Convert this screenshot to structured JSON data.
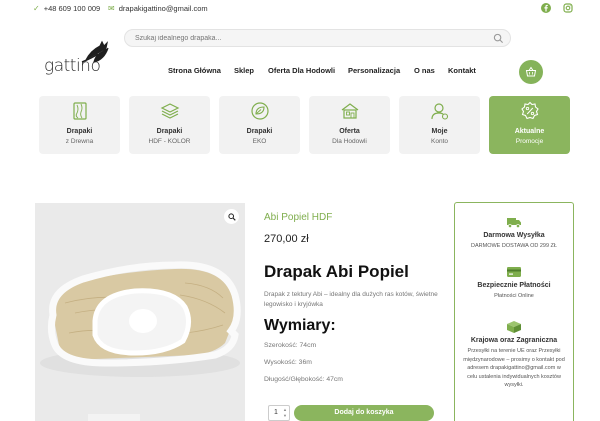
{
  "topbar": {
    "phone": "+48 609 100 009",
    "email": "drapakigattino@gmail.com",
    "social": [
      "facebook-icon",
      "instagram-icon"
    ]
  },
  "logo": {
    "text": "gattino"
  },
  "search": {
    "placeholder": "Szukaj idealnego drapaka..."
  },
  "nav": {
    "items": [
      "Strona Główna",
      "Sklep",
      "Oferta Dla Hodowli",
      "Personalizacja",
      "O nas",
      "Kontakt"
    ]
  },
  "categories": [
    {
      "name": "Drapaki",
      "sub": "z Drewna",
      "icon": "wood-icon"
    },
    {
      "name": "Drapaki",
      "sub": "HDF - KOLOR",
      "icon": "layers-icon"
    },
    {
      "name": "Drapaki",
      "sub": "EKO",
      "icon": "eco-leaf-icon"
    },
    {
      "name": "Oferta",
      "sub": "Dla Hodowli",
      "icon": "house-icon"
    },
    {
      "name": "Moje",
      "sub": "Konto",
      "icon": "user-icon"
    },
    {
      "name": "Aktualne",
      "sub": "Promocje",
      "icon": "promo-icon",
      "active": true
    }
  ],
  "product": {
    "category": "Abi Popiel HDF",
    "price": "270,00 zł",
    "title": "Drapak Abi Popiel",
    "description": "Drapak z tektury Abi – idealny dla dużych ras kotów, świetne legowisko i kryjówka",
    "dimensions_heading": "Wymiary:",
    "dimensions": [
      "Szerokość: 74cm",
      "Wysokość: 36m",
      "Długość/Głębokość: 47cm"
    ],
    "quantity": "1",
    "add_to_cart": "Dodaj do koszyka"
  },
  "info_box": [
    {
      "icon": "truck-icon",
      "heading": "Darmowa Wysyłka",
      "text": "DARMOWE DOSTAWA OD 299 ZŁ"
    },
    {
      "icon": "credit-card-icon",
      "heading": "Bezpiecznie Płatności",
      "text": "Płatności Online"
    },
    {
      "icon": "package-icon",
      "heading": "Krajowa oraz Zagraniczna",
      "text": "Przesyłki na terenie UE oraz Przesyłki międzynarodowe – prosimy o kontakt pod adresem drapakigattino@gmail.com w celu ustalenia indywidualnych kosztów wysyłki."
    }
  ],
  "colors": {
    "accent": "#8bb55e",
    "tile_bg": "#f2f2f2",
    "text": "#222222"
  }
}
